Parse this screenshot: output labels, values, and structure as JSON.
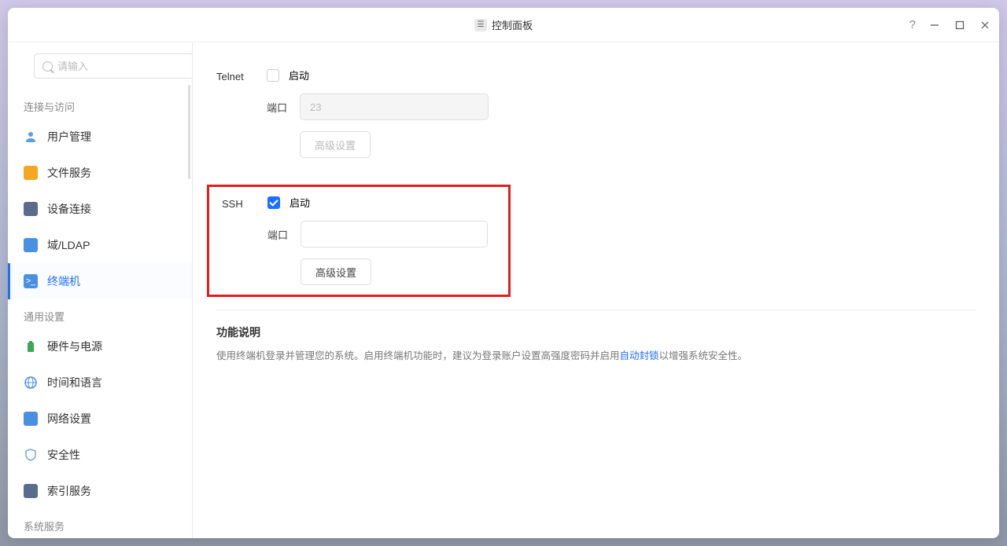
{
  "window": {
    "title": "控制面板"
  },
  "search": {
    "placeholder": "请输入"
  },
  "sidebar": {
    "section_connect": "连接与访问",
    "section_general": "通用设置",
    "section_system": "系统服务",
    "items": {
      "user_mgmt": "用户管理",
      "file_svc": "文件服务",
      "device_conn": "设备连接",
      "domain_ldap": "域/LDAP",
      "terminal": "终端机",
      "hw_power": "硬件与电源",
      "time_lang": "时间和语言",
      "network": "网络设置",
      "security": "安全性",
      "index": "索引服务"
    }
  },
  "telnet": {
    "label": "Telnet",
    "enable": "启动",
    "port_label": "端口",
    "port_value": "23",
    "advanced": "高级设置"
  },
  "ssh": {
    "label": "SSH",
    "enable": "启动",
    "port_label": "端口",
    "port_value": "",
    "advanced": "高级设置"
  },
  "description": {
    "title": "功能说明",
    "text_before": "使用终端机登录并管理您的系统。启用终端机功能时，建议为登录账户设置高强度密码并启用",
    "link": "自动封锁",
    "text_after": "以增强系统安全性。"
  },
  "colors": {
    "user_mgmt": "#5aa0e8",
    "file_svc": "#f5a623",
    "device_conn": "#5a6b8c",
    "domain_ldap": "#4a90e2",
    "terminal": "#4a90e2",
    "hw_power": "#3aa657",
    "time_lang": "#4a90e2",
    "network": "#4a90e2",
    "security": "#7aa8d8",
    "index": "#5a6b8c"
  }
}
